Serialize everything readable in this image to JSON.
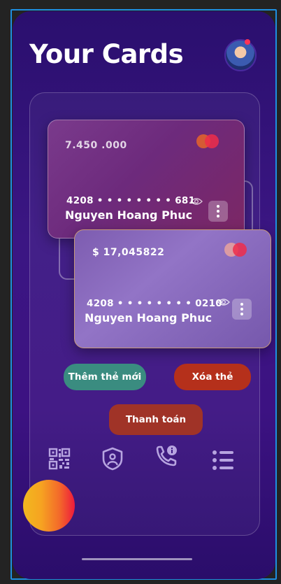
{
  "header": {
    "title": "Your Cards"
  },
  "cards": [
    {
      "balance": "7.450 .000",
      "number": "4208 • • • •  • • • •  681",
      "holder": "Nguyen Hoang Phuc"
    },
    {
      "balance": "$ 17,045822",
      "number": "4208 • • • •  • • • •  0210",
      "holder": "Nguyen Hoang Phuc"
    }
  ],
  "actions": {
    "add_label": "Thêm thẻ mới",
    "delete_label": "Xóa thẻ",
    "pay_label": "Thanh toán"
  },
  "nav": [
    {
      "icon": "qr-code-icon"
    },
    {
      "icon": "shield-user-icon"
    },
    {
      "icon": "phone-info-icon"
    },
    {
      "icon": "list-icon"
    }
  ],
  "colors": {
    "accent_green": "#3a8c80",
    "accent_red": "#b5301b",
    "pay_red": "#a03327",
    "background": "#3b1683"
  }
}
